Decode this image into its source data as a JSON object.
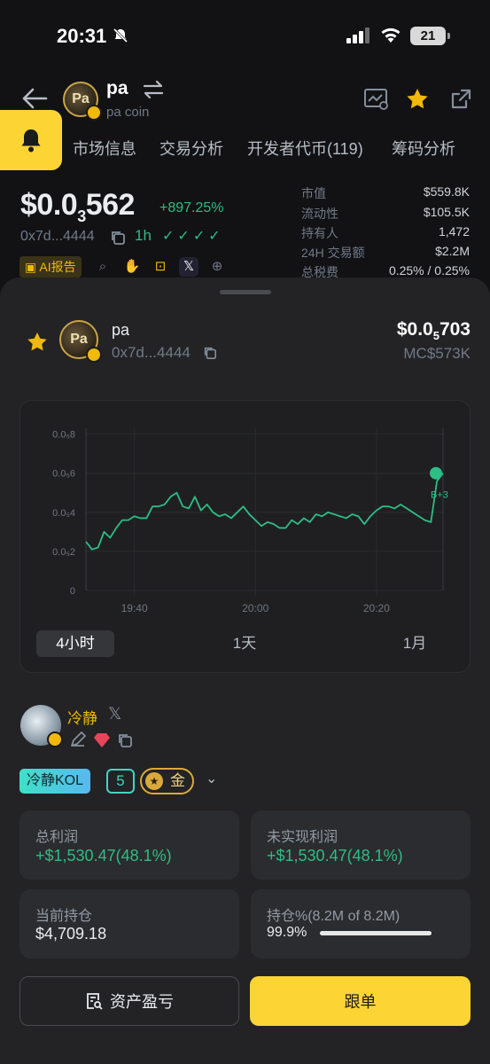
{
  "status": {
    "time": "20:31",
    "battery": "21"
  },
  "header": {
    "symbol": "pa",
    "name": "pa coin",
    "logo_text": "Pa"
  },
  "tabs": [
    "市场信息",
    "交易分析",
    "开发者代币(119)",
    "筹码分析"
  ],
  "summary": {
    "price_main": "$0.0",
    "price_sub": "3",
    "price_tail": "562",
    "change": "+897.25%",
    "address": "0x7d...4444",
    "timeframe": "1h",
    "checks": "✓✓✓✓",
    "ai_label": "AI报告"
  },
  "stats": [
    {
      "label": "市值",
      "value": "$559.8K"
    },
    {
      "label": "流动性",
      "value": "$105.5K"
    },
    {
      "label": "持有人",
      "value": "1,472"
    },
    {
      "label": "24H 交易额",
      "value": "$2.2M"
    },
    {
      "label": "总税费",
      "value": "0.25% / 0.25%"
    }
  ],
  "token": {
    "symbol": "pa",
    "address": "0x7d...4444",
    "price_main": "$0.0",
    "price_sub": "5",
    "price_tail": "703",
    "mc": "MC$573K"
  },
  "chart_data": {
    "type": "line",
    "y_ticks": [
      "0.0₅8",
      "0.0₅6",
      "0.0₅4",
      "0.0₅2",
      "0"
    ],
    "y_tick_values": [
      8,
      6,
      4,
      2,
      0
    ],
    "x_ticks": [
      "19:40",
      "20:00",
      "20:20"
    ],
    "x_tick_minutes": [
      40,
      60,
      80
    ],
    "xlim": [
      32,
      91
    ],
    "ylim": [
      0,
      8.3
    ],
    "unit_note": "",
    "marker_label": "B+3",
    "line_color": "#2ebd85",
    "x": [
      32,
      33,
      34,
      35,
      36,
      37,
      38,
      39,
      40,
      41,
      42,
      43,
      44,
      45,
      46,
      47,
      48,
      49,
      50,
      51,
      52,
      53,
      54,
      55,
      56,
      57,
      58,
      59,
      60,
      61,
      62,
      63,
      64,
      65,
      66,
      67,
      68,
      69,
      70,
      71,
      72,
      73,
      74,
      75,
      76,
      77,
      78,
      79,
      80,
      81,
      82,
      83,
      84,
      85,
      86,
      87,
      88,
      89,
      90,
      91
    ],
    "y": [
      0.7,
      0.9,
      0.6,
      1.2,
      1.8,
      2.2,
      2.6,
      3.0,
      2.5,
      2.1,
      2.2,
      3.0,
      2.7,
      3.2,
      3.6,
      3.6,
      3.8,
      3.7,
      3.7,
      4.3,
      4.3,
      4.4,
      4.8,
      5.0,
      4.3,
      4.2,
      4.8,
      4.1,
      4.4,
      4.0,
      3.8,
      3.9,
      3.7,
      4.0,
      4.3,
      3.9,
      3.6,
      3.3,
      3.5,
      3.4,
      3.2,
      3.2,
      3.6,
      3.4,
      3.7,
      3.5,
      3.9,
      3.8,
      4.0,
      3.9,
      3.8,
      3.7,
      3.9,
      3.8,
      3.4,
      3.8,
      4.1,
      4.3,
      4.3,
      4.2,
      4.4,
      4.2,
      4.0,
      3.8,
      3.6,
      3.5,
      5.6,
      6.0
    ],
    "ranges": [
      "4小时",
      "1天",
      "1月"
    ],
    "active_range": "4小时"
  },
  "trader": {
    "name": "冷静",
    "kol": "冷静KOL",
    "level": "5",
    "tier": "金",
    "tier_coin": "★",
    "total_profit_label": "总利润",
    "total_profit": "+$1,530.47(48.1%)",
    "unrealized_label": "未实现利润",
    "unrealized": "+$1,530.47(48.1%)",
    "holding_label": "当前持仓",
    "holding": "$4,709.18",
    "position_label": "持仓%(8.2M of 8.2M)",
    "position_pct": "99.9%",
    "position_fraction": 0.999
  },
  "actions": {
    "pnl": "资产盈亏",
    "follow": "跟单"
  }
}
